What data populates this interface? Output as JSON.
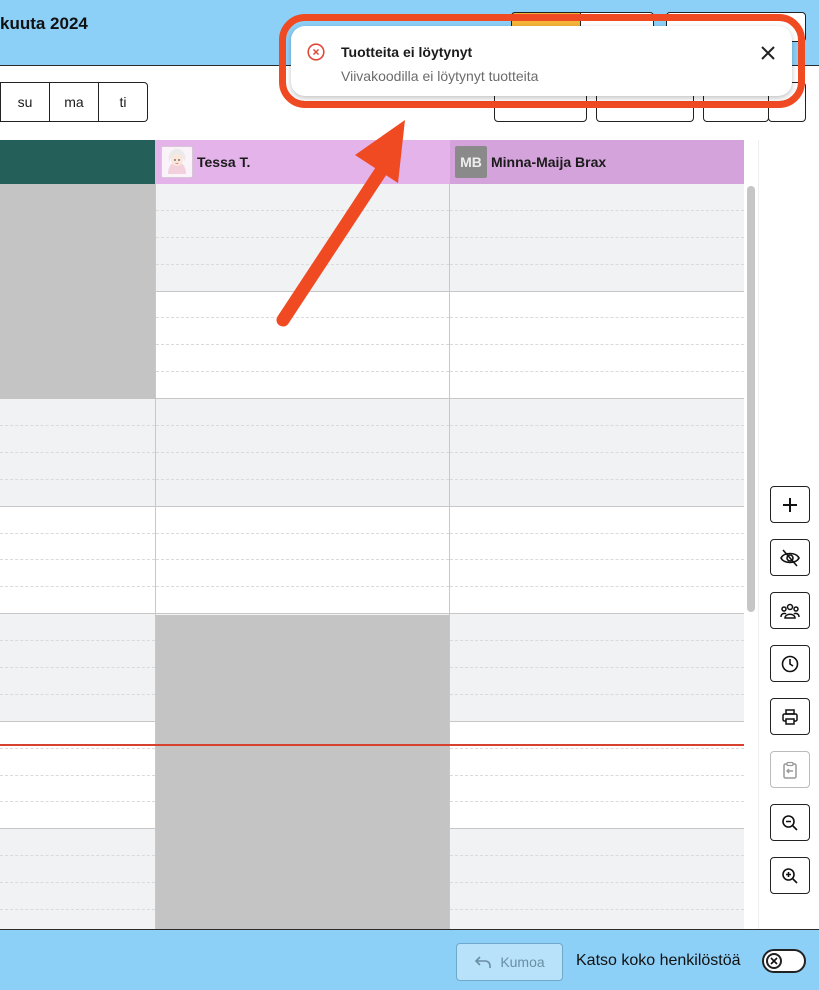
{
  "header": {
    "title": "kuuta 2024"
  },
  "day_selector": {
    "days": [
      "su",
      "ma",
      "ti"
    ]
  },
  "columns": [
    {
      "name": "",
      "color": "#245f5a"
    },
    {
      "name": "Tessa T.",
      "avatar": "portrait-avatar",
      "color": "#e3b3ea"
    },
    {
      "name": "Minna-Maija Brax",
      "initials": "MB",
      "color": "#d5a3dc"
    }
  ],
  "sidebar_tools": [
    "add-icon",
    "hide-icon",
    "team-icon",
    "clock-icon",
    "print-icon",
    "clipboard-icon",
    "zoom-out-icon",
    "zoom-in-icon"
  ],
  "notification": {
    "title": "Tuotteita ei löytynyt",
    "message": "Viivakoodilla ei löytynyt tuotteita",
    "type": "error",
    "icon": "error-circle-icon"
  },
  "footer": {
    "undo_label": "Kumoa",
    "see_all_label": "Katso koko henkilöstöä"
  },
  "colors": {
    "accent": "#8ccff7",
    "highlight": "#f04a23",
    "now_line": "#d8412f"
  }
}
